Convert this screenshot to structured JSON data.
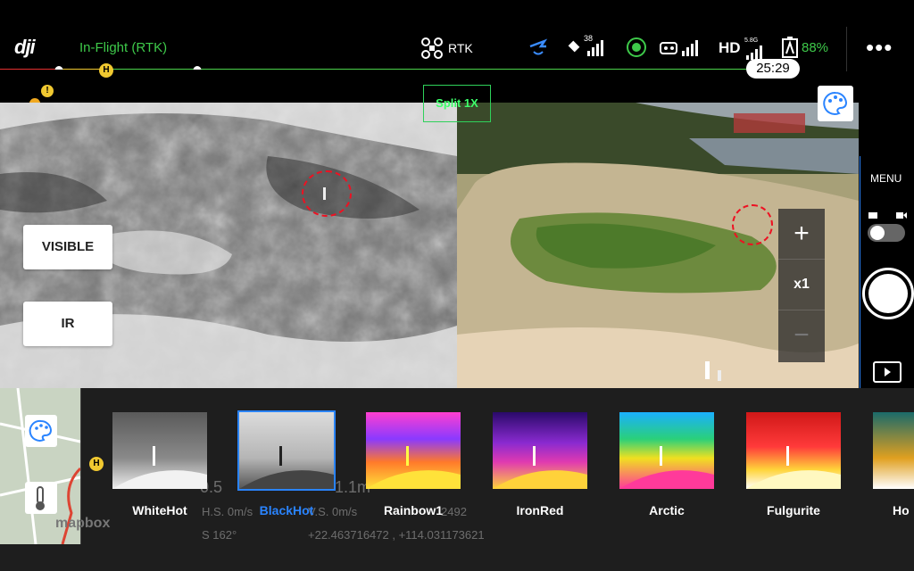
{
  "topbar": {
    "brand": "dji",
    "flight_status": "In-Flight (RTK)",
    "rtk_label": "RTK",
    "hd_label": "HD",
    "hd_band": "5.8G",
    "battery": "88%",
    "gps_count": "38",
    "more": "•••"
  },
  "progress": {
    "time": "25:29",
    "home_marker": "H",
    "warning_marker": "!"
  },
  "views": {
    "split_label": "Split 1X",
    "visible_button": "VISIBLE",
    "ir_button": "IR"
  },
  "zoom": {
    "plus": "+",
    "level": "x1",
    "minus": "−"
  },
  "right_panel": {
    "menu": "MENU"
  },
  "palettes": [
    {
      "name": "WhiteHot",
      "selected": false
    },
    {
      "name": "BlackHot",
      "selected": true
    },
    {
      "name": "Rainbow1",
      "selected": false
    },
    {
      "name": "IronRed",
      "selected": false
    },
    {
      "name": "Arctic",
      "selected": false
    },
    {
      "name": "Fulgurite",
      "selected": false
    },
    {
      "name": "Ho",
      "selected": false
    }
  ],
  "map": {
    "attribution": "mapbox",
    "home": "H"
  },
  "telemetry": {
    "d": "0.5",
    "h": "1.1m",
    "hs": "H.S. 0m/s",
    "vs": "V.S. 0m/s",
    "id": "2492",
    "s": "S  162°",
    "coords": "+22.463716472 , +114.031173621"
  },
  "colors": {
    "accent_green": "#3ec94a",
    "selected_blue": "#2a84ff",
    "target_red": "#e11"
  }
}
